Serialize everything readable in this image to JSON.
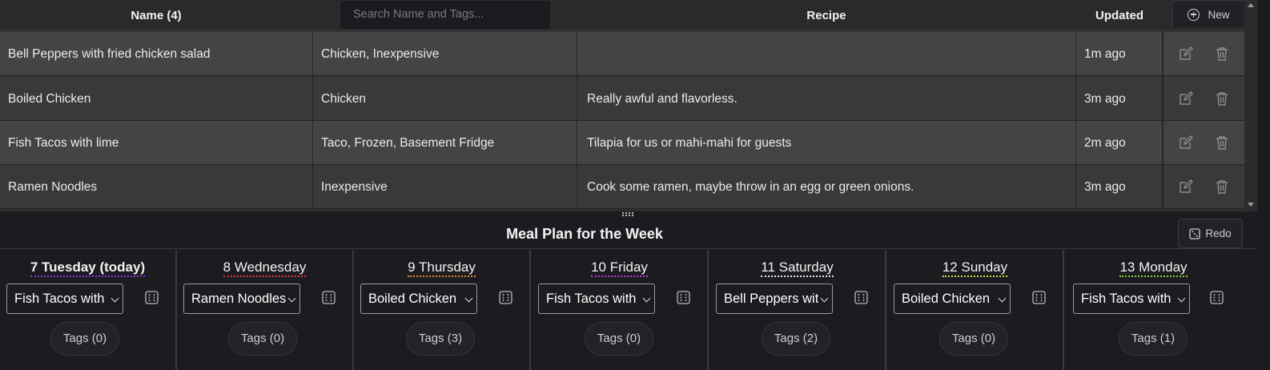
{
  "table": {
    "headers": {
      "name": "Name (4)",
      "recipe": "Recipe",
      "updated": "Updated"
    },
    "search_placeholder": "Search Name and Tags...",
    "new_label": "New",
    "rows": [
      {
        "name": "Bell Peppers with fried chicken salad",
        "tags": "Chicken, Inexpensive",
        "recipe": "",
        "updated": "1m ago"
      },
      {
        "name": "Boiled Chicken",
        "tags": "Chicken",
        "recipe": "Really awful and flavorless.",
        "updated": "3m ago"
      },
      {
        "name": "Fish Tacos with lime",
        "tags": "Taco, Frozen, Basement Fridge",
        "recipe": "Tilapia for us or mahi-mahi for guests",
        "updated": "2m ago"
      },
      {
        "name": "Ramen Noodles",
        "tags": "Inexpensive",
        "recipe": "Cook some ramen, maybe throw in an egg or green onions.",
        "updated": "3m ago"
      }
    ]
  },
  "plan": {
    "title": "Meal Plan for the Week",
    "redo_label": "Redo",
    "days": [
      {
        "label": "7 Tuesday (today)",
        "meal": "Fish Tacos with lime",
        "tags": "Tags (0)",
        "underline": "#7b3fe4"
      },
      {
        "label": "8 Wednesday",
        "meal": "Ramen Noodles",
        "tags": "Tags (0)",
        "underline": "#e0344a"
      },
      {
        "label": "9 Thursday",
        "meal": "Boiled Chicken",
        "tags": "Tags (3)",
        "underline": "#e08a2a"
      },
      {
        "label": "10 Friday",
        "meal": "Fish Tacos with lime",
        "tags": "Tags (0)",
        "underline": "#c93ad6"
      },
      {
        "label": "11 Saturday",
        "meal": "Bell Peppers with fried chicken salad",
        "tags": "Tags (2)",
        "underline": "#e8e8e8"
      },
      {
        "label": "12 Sunday",
        "meal": "Boiled Chicken",
        "tags": "Tags (0)",
        "underline": "#c8d83a"
      },
      {
        "label": "13 Monday",
        "meal": "Fish Tacos with lime",
        "tags": "Tags (1)",
        "underline": "#7ed12f"
      }
    ]
  }
}
